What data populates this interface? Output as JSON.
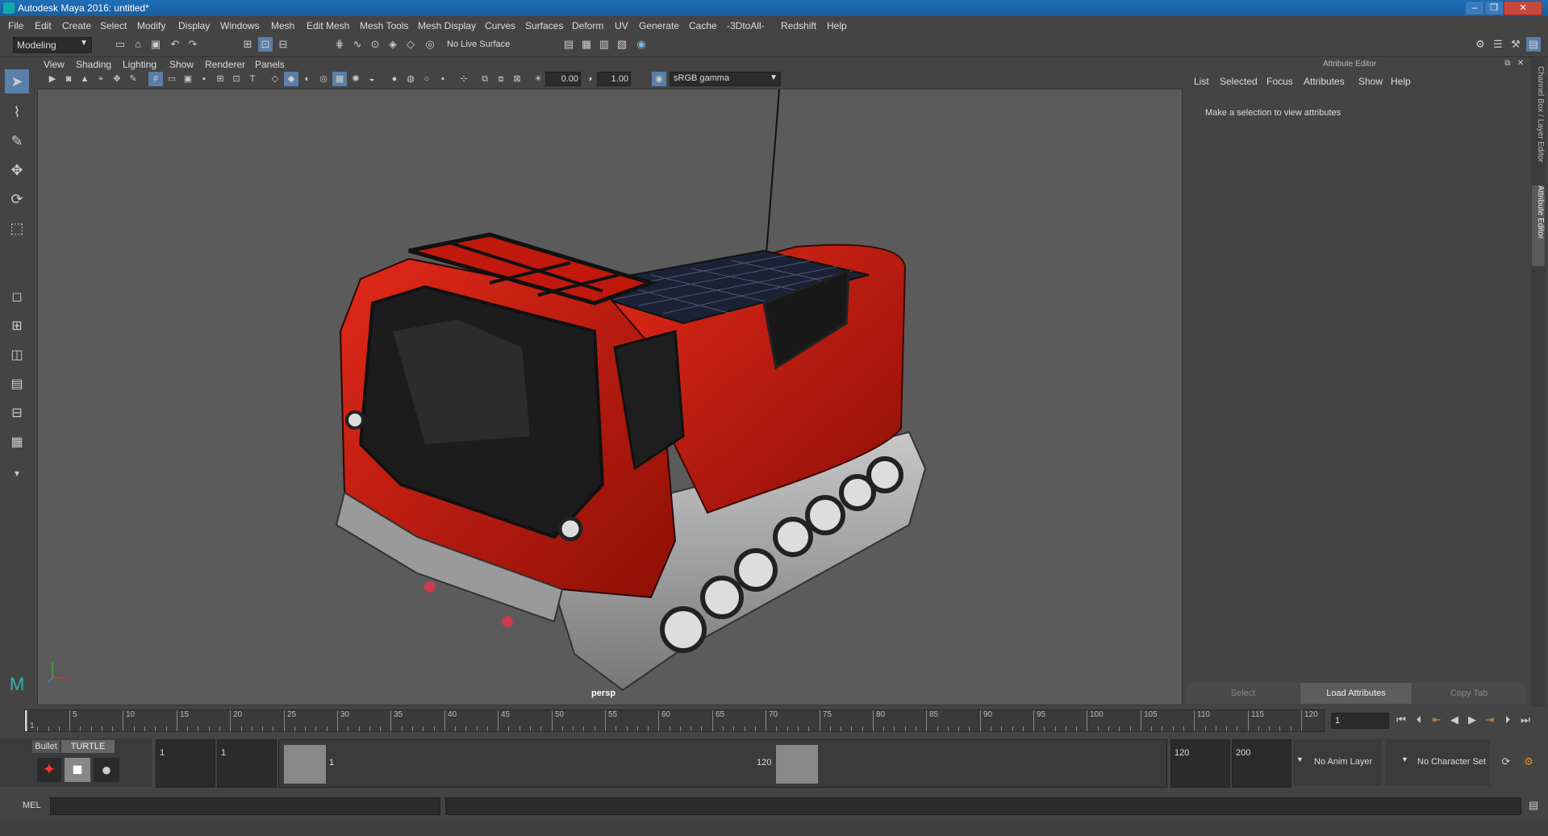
{
  "window": {
    "title": "Autodesk Maya 2016: untitled*"
  },
  "menubar": [
    "File",
    "Edit",
    "Create",
    "Select",
    "Modify",
    "Display",
    "Windows",
    "Mesh",
    "Edit Mesh",
    "Mesh Tools",
    "Mesh Display",
    "Curves",
    "Surfaces",
    "Deform",
    "UV",
    "Generate",
    "Cache",
    "-3DtoAll-",
    "Redshift",
    "Help"
  ],
  "status": {
    "menuset": "Modeling",
    "live_surface": "No Live Surface"
  },
  "viewport": {
    "menu": [
      "View",
      "Shading",
      "Lighting",
      "Show",
      "Renderer",
      "Panels"
    ],
    "exposure": "0.00",
    "gamma": "1.00",
    "colorspace": "sRGB gamma",
    "camera_label": "persp"
  },
  "attribute_editor": {
    "title": "Attribute Editor",
    "menu": [
      "List",
      "Selected",
      "Focus",
      "Attributes",
      "Show",
      "Help"
    ],
    "message": "Make a selection to view attributes",
    "buttons": [
      "Select",
      "Load Attributes",
      "Copy Tab"
    ],
    "side_tabs": [
      "Channel Box / Layer Editor",
      "Attribute Editor"
    ]
  },
  "timeline": {
    "ticks": [
      "1",
      "5",
      "10",
      "15",
      "20",
      "25",
      "30",
      "35",
      "40",
      "45",
      "50",
      "55",
      "60",
      "65",
      "70",
      "75",
      "80",
      "85",
      "90",
      "95",
      "100",
      "105",
      "110",
      "115",
      "120"
    ],
    "current_frame": "1"
  },
  "range": {
    "shelf_tabs": [
      "Bullet",
      "TURTLE"
    ],
    "start": "1",
    "anim_start": "1",
    "slider_start": "1",
    "slider_end": "120",
    "anim_end": "120",
    "end": "200",
    "anim_layer": "No Anim Layer",
    "char_set": "No Character Set"
  },
  "command": {
    "label": "MEL"
  }
}
